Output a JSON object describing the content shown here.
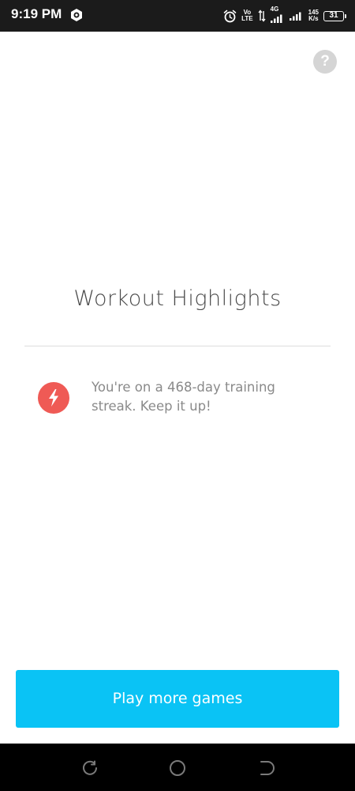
{
  "status_bar": {
    "time": "9:19 PM",
    "network_top": "Vo",
    "network_bottom": "LTE",
    "network_gen": "4G",
    "speed_value": "145",
    "speed_unit": "K/s",
    "battery": "31",
    "icons": [
      "app-notification-icon",
      "alarm-icon",
      "data-arrows-icon",
      "signal-icon",
      "signal-icon-2",
      "battery-icon"
    ]
  },
  "help": {
    "label": "?"
  },
  "main": {
    "title": "Workout Highlights",
    "highlights": [
      {
        "icon": "lightning-bolt-icon",
        "text": "You're on a 468-day training streak. Keep it up!"
      }
    ]
  },
  "actions": {
    "play_label": "Play more games"
  },
  "navigation": {
    "buttons": [
      "recents-icon",
      "home-icon",
      "back-icon"
    ]
  },
  "colors": {
    "accent": "#0ac3f5",
    "streak": "#ef5a55",
    "help_bg": "#d5d5d5",
    "title": "#4a4a4a",
    "body_text": "#8a8a8a"
  }
}
